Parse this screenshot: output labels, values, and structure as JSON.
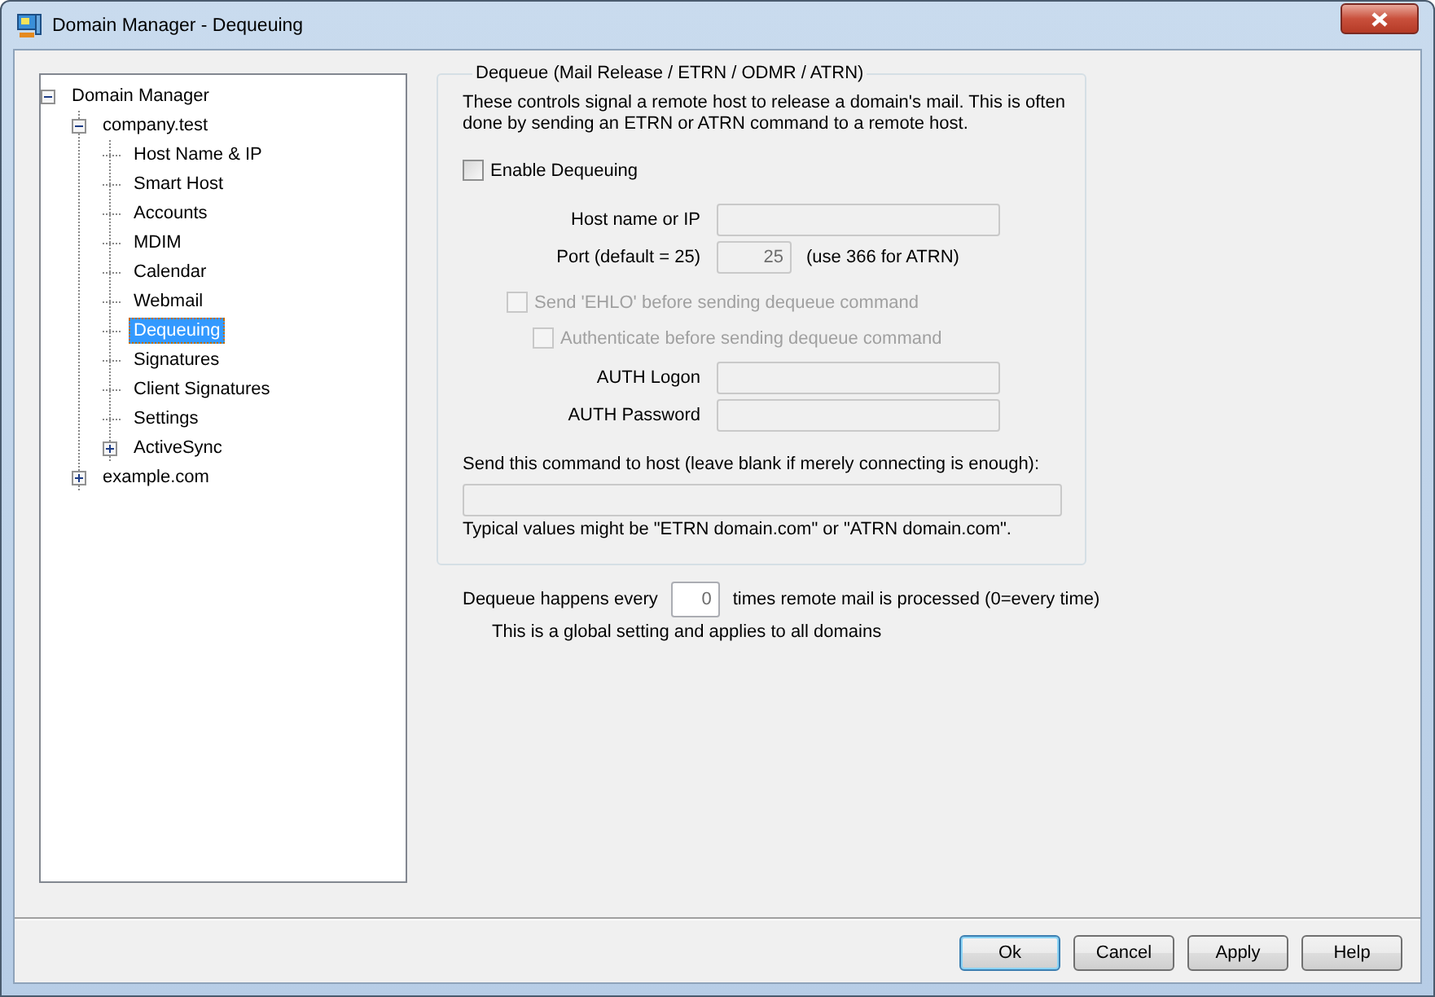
{
  "window": {
    "title": "Domain Manager - Dequeuing"
  },
  "tree": [
    {
      "label": "Domain Manager",
      "selected": false,
      "expanded": true,
      "children": [
        {
          "label": "company.test",
          "selected": false,
          "expanded": true,
          "children": [
            {
              "label": "Host Name & IP",
              "selected": false
            },
            {
              "label": "Smart Host",
              "selected": false
            },
            {
              "label": "Accounts",
              "selected": false
            },
            {
              "label": "MDIM",
              "selected": false
            },
            {
              "label": "Calendar",
              "selected": false
            },
            {
              "label": "Webmail",
              "selected": false
            },
            {
              "label": "Dequeuing",
              "selected": true
            },
            {
              "label": "Signatures",
              "selected": false
            },
            {
              "label": "Client Signatures",
              "selected": false
            },
            {
              "label": "Settings",
              "selected": false
            },
            {
              "label": "ActiveSync",
              "selected": false,
              "expanded": false
            }
          ]
        },
        {
          "label": "example.com",
          "selected": false,
          "expanded": false
        }
      ]
    }
  ],
  "group": {
    "title": "Dequeue (Mail Release / ETRN / ODMR / ATRN)",
    "description": "These controls signal a remote host to release a domain's mail.  This is often done by sending an ETRN or ATRN command to a remote host.",
    "enable": {
      "label": "Enable Dequeuing",
      "checked": false,
      "disabled": false
    },
    "host_fields": [
      {
        "label": "Host name or IP",
        "disabled": true
      },
      {
        "label": "Port (default = 25)",
        "value": "25",
        "disabled": true,
        "note": "(use 366 for ATRN)"
      }
    ],
    "ehlo": {
      "label": "Send 'EHLO' before sending dequeue command",
      "checked": false,
      "disabled": true
    },
    "authenticate": {
      "label": "Authenticate before sending dequeue command",
      "checked": false,
      "disabled": true
    },
    "auth_fields": [
      {
        "label": "AUTH Logon",
        "disabled": true
      },
      {
        "label": "AUTH Password",
        "disabled": true
      }
    ],
    "command": {
      "label": "Send this command to host (leave blank if merely connecting is enough):",
      "disabled": true,
      "hint": "Typical values might be \"ETRN domain.com\" or \"ATRN domain.com\"."
    }
  },
  "interval": {
    "prefix": "Dequeue happens every",
    "value": "0",
    "suffix": "times remote mail is processed (0=every time)",
    "note": "This is a global setting and applies to all domains"
  },
  "buttons": [
    {
      "label": "Ok",
      "default": true
    },
    {
      "label": "Cancel",
      "default": false
    },
    {
      "label": "Apply",
      "default": false
    },
    {
      "label": "Help",
      "default": false
    }
  ]
}
